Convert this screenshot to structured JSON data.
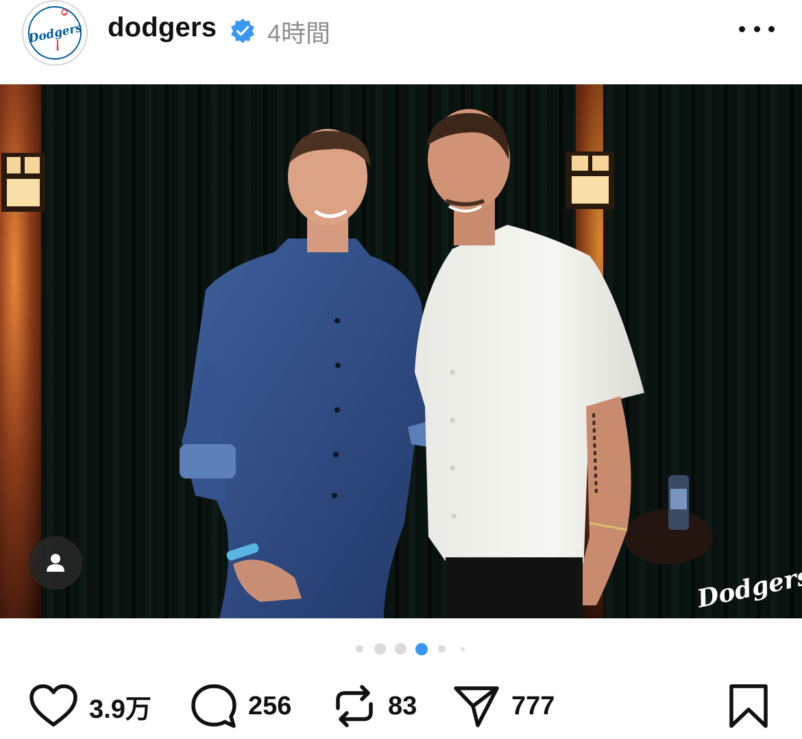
{
  "post": {
    "account": {
      "username": "dodgers",
      "verified": true,
      "time_ago": "4時間",
      "avatar_logo_text": "Dodgers"
    },
    "media": {
      "watermark_text": "Dodgers",
      "carousel": {
        "total": 6,
        "current_index": 3
      }
    },
    "stats": {
      "likes": "3.9万",
      "comments": "256",
      "reposts": "83",
      "shares": "777"
    },
    "icons": {
      "like": "heart-icon",
      "comment": "comment-bubble-icon",
      "repost": "repost-icon",
      "share": "send-icon",
      "save": "bookmark-icon",
      "more": "more-options-icon",
      "tagged": "person-tag-icon",
      "verified": "verified-badge-icon"
    },
    "colors": {
      "accent": "#3897f0",
      "brand_blue": "#005A9C",
      "muted_text": "#8e8e8e"
    }
  }
}
